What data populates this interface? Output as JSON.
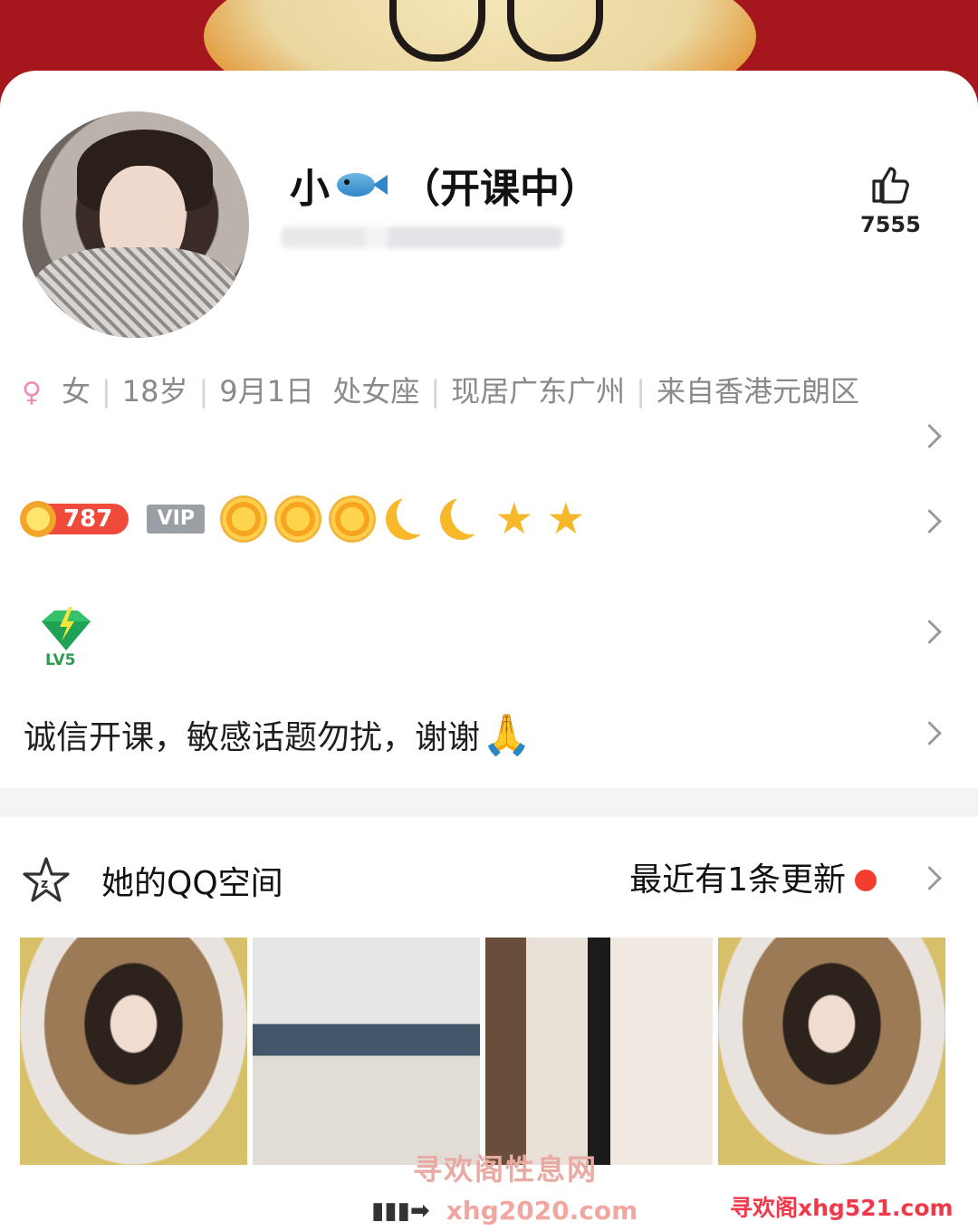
{
  "profile": {
    "nickname_prefix": "小",
    "nickname_suffix": "（开课中）",
    "likes_count": "7555",
    "gender": "女",
    "age": "18岁",
    "birthday": "9月1日",
    "zodiac": "处女座",
    "location": "现居广东广州",
    "hometown": "来自香港元朗区",
    "coin_level": "787",
    "vip_label": "VIP",
    "badge_level": "LV5",
    "signature": "诚信开课，敏感话题勿扰，谢谢"
  },
  "qzone": {
    "title": "她的QQ空间",
    "update_text": "最近有1条更新"
  },
  "icons": {
    "female": "female-symbol-icon",
    "like": "thumbs-up-icon",
    "star": "star-outline-icon",
    "chevron": "chevron-right-icon"
  },
  "colors": {
    "banner": "#a5171c",
    "accent_red": "#f33e2f",
    "coin": "#ef4a3b",
    "muted_text": "#8a8a8e"
  },
  "watermarks": {
    "line1": "寻欢阁性息网",
    "line2": "xhg2020.com",
    "line3": "寻欢阁xhg521.com"
  }
}
